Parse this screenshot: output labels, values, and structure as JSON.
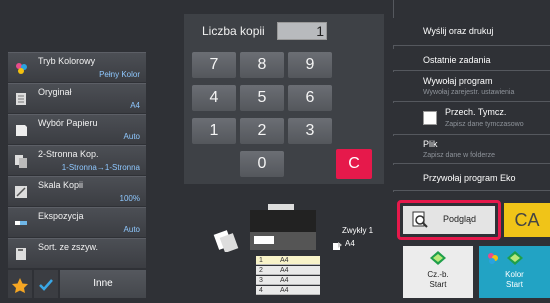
{
  "left_panel": {
    "items": [
      {
        "label": "Tryb Kolorowy",
        "value": "Pełny Kolor"
      },
      {
        "label": "Oryginał",
        "value": "A4"
      },
      {
        "label": "Wybór Papieru",
        "value": "Auto"
      },
      {
        "label": "2-Stronna Kop.",
        "value": "1-Stronna→1-Stronna"
      },
      {
        "label": "Skala Kopii",
        "value": "100%"
      },
      {
        "label": "Ekspozycja",
        "value": "Auto"
      },
      {
        "label": "Sort. ze zszyw.",
        "value": ""
      }
    ],
    "bottom": {
      "other_label": "Inne"
    }
  },
  "keypad": {
    "title": "Liczba kopii",
    "count": "1",
    "keys": [
      "7",
      "8",
      "9",
      "4",
      "5",
      "6",
      "1",
      "2",
      "3",
      "0"
    ],
    "clear_label": "C"
  },
  "right_menu": {
    "header": "Wyślij oraz drukuj",
    "items": [
      {
        "title": "Ostatnie zadania",
        "sub": ""
      },
      {
        "title": "Wywołaj program",
        "sub": "Wywołaj zarejestr. ustawienia"
      },
      {
        "title": "Przech. Tymcz.",
        "sub": "Zapisz dane tymczasowo"
      },
      {
        "title": "Plik",
        "sub": "Zapisz dane w folderze"
      },
      {
        "title": "Przywołaj program Eko",
        "sub": ""
      }
    ]
  },
  "machine": {
    "output_label": "Zwykły 1",
    "output_size": "A4",
    "trays": [
      {
        "num": "1",
        "size": "A4"
      },
      {
        "num": "2",
        "size": "A4"
      },
      {
        "num": "3",
        "size": "A4"
      },
      {
        "num": "4",
        "size": "A4"
      }
    ]
  },
  "actions": {
    "preview_label": "Podgląd",
    "ca_label": "CA",
    "bw_start_label": "Cz.-b.\nStart",
    "color_start_label": "Kolor\nStart"
  },
  "colors": {
    "accent_red": "#e6194b",
    "ca_yellow": "#f0c418",
    "start_teal": "#22a3c4",
    "value_blue": "#8fc8ff"
  }
}
